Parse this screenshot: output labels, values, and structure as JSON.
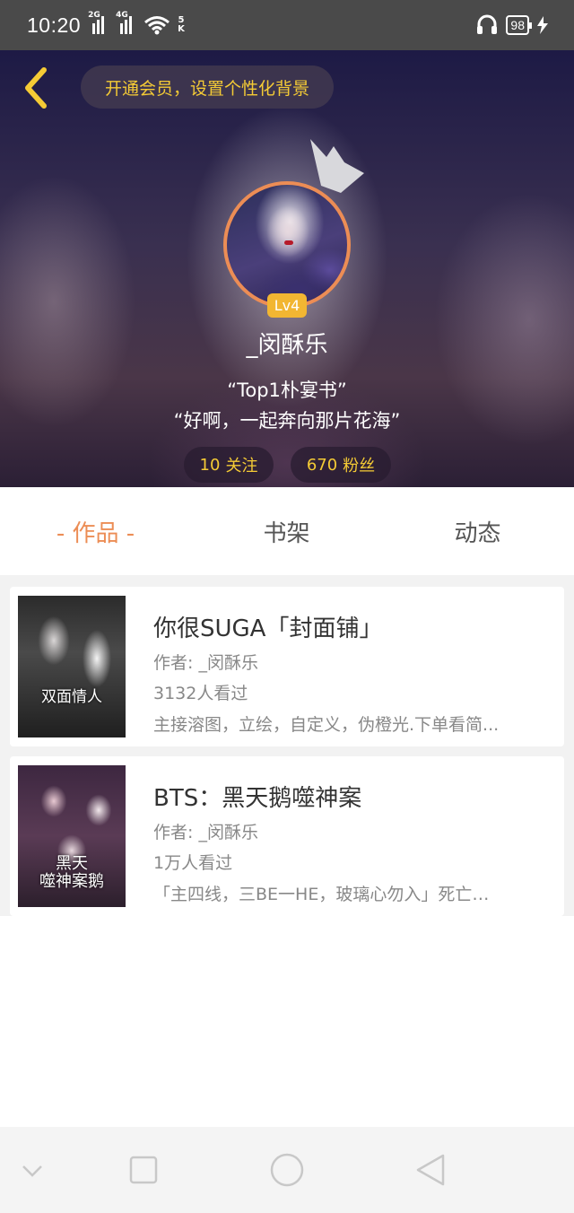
{
  "status_bar": {
    "time": "10:20",
    "signal_1_gen": "2G",
    "signal_2_gen": "4G",
    "speed_value": "5",
    "speed_unit": "K",
    "battery": "98"
  },
  "header": {
    "vip_banner": "开通会员，设置个性化背景",
    "level": "Lv4",
    "username": "_闵酥乐",
    "bio_line_1": "“Top1朴宴书”",
    "bio_line_2": "“好啊，一起奔向那片花海”",
    "following_count": "10",
    "following_label": "关注",
    "fans_count": "670",
    "fans_label": "粉丝"
  },
  "tabs": [
    {
      "label": "- 作品 -",
      "active": true
    },
    {
      "label": "书架",
      "active": false
    },
    {
      "label": "动态",
      "active": false
    }
  ],
  "books": [
    {
      "title": "你很SUGA「封面铺」",
      "author": "作者: _闵酥乐",
      "views": "3132人看过",
      "description": "主接溶图，立绘，自定义，伪橙光.下单看简...",
      "cover_text": "双面情人"
    },
    {
      "title": "BTS：黑天鹅噬神案",
      "author": "作者: _闵酥乐",
      "views": "1万人看过",
      "description": "「主四线，三BE一HE，玻璃心勿入」死亡…",
      "cover_text_1": "黑天",
      "cover_text_2": "噬神案鹅"
    }
  ],
  "colors": {
    "accent": "#ec8d55",
    "gold": "#f5cb35",
    "badge": "#f2b632"
  },
  "icons": [
    "back-chevron-icon",
    "crown-icon",
    "headset-icon",
    "charging-icon",
    "wifi-icon",
    "nav-down-icon",
    "nav-square-icon",
    "nav-circle-icon",
    "nav-triangle-icon"
  ]
}
